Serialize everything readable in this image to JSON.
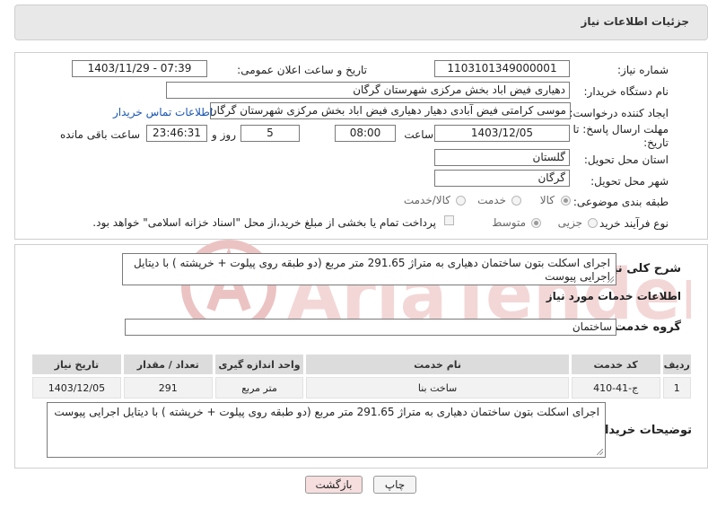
{
  "header": {
    "title": "جزئیات اطلاعات نیاز"
  },
  "form": {
    "need_number_label": "شماره نیاز:",
    "need_number": "1103101349000001",
    "announce_label": "تاریخ و ساعت اعلان عمومی:",
    "announce_value": "1403/11/29 - 07:39",
    "buyer_label": "نام دستگاه خریدار:",
    "buyer_value": "دهیاری فیض اباد بخش مرکزی شهرستان گرگان",
    "creator_label": "ایجاد کننده درخواست:",
    "creator_value": "موسی کرامتی فیض آبادی دهیار دهیاری فیض اباد بخش مرکزی شهرستان گرگان",
    "contact_link": "اطلاعات تماس خریدار",
    "deadline_label_1": "مهلت ارسال پاسخ: تا",
    "deadline_label_2": "تاریخ:",
    "deadline_date": "1403/12/05",
    "time_label": "ساعت",
    "deadline_time": "08:00",
    "days_value": "5",
    "days_label": "روز و",
    "remaining_time": "23:46:31",
    "remaining_label": "ساعت باقی مانده",
    "province_label": "استان محل تحویل:",
    "province_value": "گلستان",
    "city_label": "شهر محل تحویل:",
    "city_value": "گرگان",
    "category_label": "طبقه بندی موضوعی:",
    "category_options": [
      "کالا",
      "خدمت",
      "کالا/خدمت"
    ],
    "process_label": "نوع فرآیند خرید :",
    "process_options": [
      "جزیی",
      "متوسط"
    ],
    "payment_note": "پرداخت تمام یا بخشی از مبلغ خرید،از محل \"اسناد خزانه اسلامی\" خواهد بود."
  },
  "description": {
    "label": "شرح کلی نیاز:",
    "text": "اجرای اسکلت بتون ساختمان دهیاری به متراژ 291.65 متر مربع (دو طبقه روی پیلوت + خرپشته ) با دیتایل اجرایی پیوست"
  },
  "services": {
    "section_title": "اطلاعات خدمات مورد نیاز",
    "group_label": "گروه خدمت:",
    "group_value": "ساختمان",
    "columns": [
      "ردیف",
      "کد خدمت",
      "نام خدمت",
      "واحد اندازه گیری",
      "تعداد / مقدار",
      "تاریخ نیاز"
    ],
    "rows": [
      [
        "1",
        "ج-41-410",
        "ساخت بنا",
        "متر مربع",
        "291",
        "1403/12/05"
      ]
    ]
  },
  "buyer_notes": {
    "label": "توضیحات خریدار:",
    "text": "اجرای اسکلت بتون ساختمان دهیاری به متراژ 291.65 متر مربع (دو طبقه روی پیلوت + خرپشته ) با دیتایل اجرایی پیوست"
  },
  "buttons": {
    "print": "چاپ",
    "back": "بازگشت"
  },
  "watermark": {
    "text": "AriaTender.neT"
  },
  "colors": {
    "link": "#1a56b0",
    "watermark": "#e9b9b9",
    "back_button": "#f6dede"
  }
}
